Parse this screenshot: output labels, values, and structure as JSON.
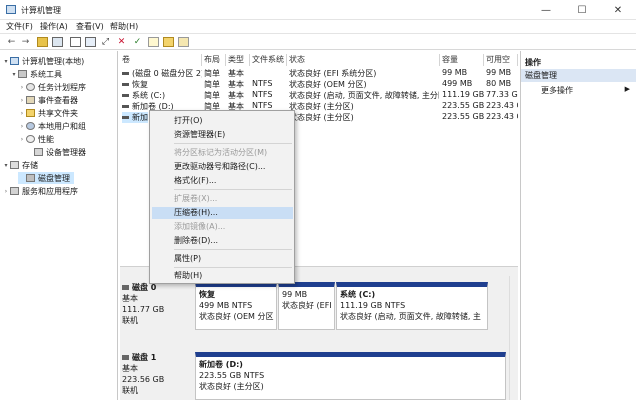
{
  "window": {
    "title": "计算机管理"
  },
  "menubar": [
    "文件(F)",
    "操作(A)",
    "查看(V)",
    "帮助(H)"
  ],
  "tree": {
    "root": "计算机管理(本地)",
    "system_tools": "系统工具",
    "task_scheduler": "任务计划程序",
    "event_viewer": "事件查看器",
    "shared_folders": "共享文件夹",
    "local_users": "本地用户和组",
    "performance": "性能",
    "device_manager": "设备管理器",
    "storage": "存储",
    "disk_management": "磁盘管理",
    "services": "服务和应用程序"
  },
  "list": {
    "headers": [
      "卷",
      "布局",
      "类型",
      "文件系统",
      "状态",
      "容量",
      "可用空"
    ],
    "rows": [
      [
        "(磁盘 0 磁盘分区 2)",
        "简单",
        "基本",
        "",
        "状态良好 (EFI 系统分区)",
        "99 MB",
        "99 MB"
      ],
      [
        "恢复",
        "简单",
        "基本",
        "NTFS",
        "状态良好 (OEM 分区)",
        "499 MB",
        "80 MB"
      ],
      [
        "系统 (C:)",
        "简单",
        "基本",
        "NTFS",
        "状态良好 (启动, 页面文件, 故障转储, 主分区)",
        "111.19 GB",
        "77.33 G"
      ],
      [
        "新加卷 (D:)",
        "简单",
        "基本",
        "NTFS",
        "状态良好 (主分区)",
        "223.55 GB",
        "223.43 G"
      ],
      [
        "新加",
        "",
        "",
        "",
        "状态良好 (主分区)",
        "223.55 GB",
        "223.43 G"
      ]
    ]
  },
  "context_menu": {
    "items": [
      {
        "label": "打开(O)",
        "disabled": false
      },
      {
        "label": "资源管理器(E)",
        "disabled": false
      },
      {
        "label": "将分区标记为活动分区(M)",
        "disabled": true
      },
      {
        "label": "更改驱动器号和路径(C)...",
        "disabled": false
      },
      {
        "label": "格式化(F)...",
        "disabled": false
      },
      {
        "label": "扩展卷(X)...",
        "disabled": true
      },
      {
        "label": "压缩卷(H)...",
        "disabled": false,
        "highlighted": true
      },
      {
        "label": "添加镜像(A)...",
        "disabled": true
      },
      {
        "label": "删除卷(D)...",
        "disabled": false
      },
      {
        "label": "属性(P)",
        "disabled": false
      },
      {
        "label": "帮助(H)",
        "disabled": false
      }
    ]
  },
  "disks": [
    {
      "name": "磁盘 0",
      "type": "基本",
      "size": "111.77 GB",
      "status": "联机",
      "partitions": [
        {
          "name": "恢复",
          "size": "499 MB NTFS",
          "status": "状态良好 (OEM 分区"
        },
        {
          "name": "",
          "size": "99 MB",
          "status": "状态良好 (EFI 系"
        },
        {
          "name": "系统 (C:)",
          "size": "111.19 GB NTFS",
          "status": "状态良好 (启动, 页面文件, 故障转储, 主"
        }
      ]
    },
    {
      "name": "磁盘 1",
      "type": "基本",
      "size": "223.56 GB",
      "status": "联机",
      "partitions": [
        {
          "name": "新加卷 (D:)",
          "size": "223.55 GB NTFS",
          "status": "状态良好 (主分区)"
        }
      ]
    }
  ],
  "actions": {
    "title": "操作",
    "section": "磁盘管理",
    "more": "更多操作"
  },
  "colors": {
    "partition_header": "#1f3f8f",
    "selection": "#cce8ff",
    "menu_highlight": "#c9def5"
  }
}
